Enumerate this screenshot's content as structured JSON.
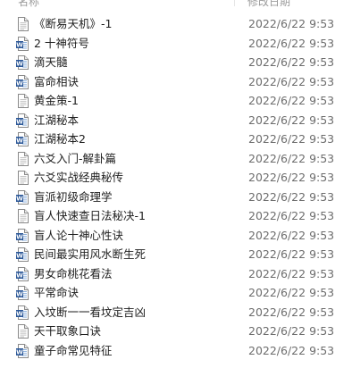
{
  "columns": {
    "name": "名称",
    "date": "修改日期"
  },
  "files": [
    {
      "name": "《断易天机》-1",
      "date": "2022/6/22 9:53",
      "icon": "text-document-icon"
    },
    {
      "name": "2 十神符号",
      "date": "2022/6/22 9:53",
      "icon": "word-document-icon"
    },
    {
      "name": "滴天髓",
      "date": "2022/6/22 9:53",
      "icon": "word-document-icon"
    },
    {
      "name": "富命相诀",
      "date": "2022/6/22 9:53",
      "icon": "word-document-icon"
    },
    {
      "name": "黄金策-1",
      "date": "2022/6/22 9:53",
      "icon": "text-document-icon"
    },
    {
      "name": "江湖秘本",
      "date": "2022/6/22 9:53",
      "icon": "word-document-icon"
    },
    {
      "name": "江湖秘本2",
      "date": "2022/6/22 9:53",
      "icon": "word-document-icon"
    },
    {
      "name": "六爻入门-解卦篇",
      "date": "2022/6/22 9:53",
      "icon": "text-document-icon"
    },
    {
      "name": "六爻实战经典秘传",
      "date": "2022/6/22 9:53",
      "icon": "text-document-icon"
    },
    {
      "name": "盲派初级命理学",
      "date": "2022/6/22 9:53",
      "icon": "word-document-icon"
    },
    {
      "name": "盲人快速查日法秘决-1",
      "date": "2022/6/22 9:53",
      "icon": "text-document-icon"
    },
    {
      "name": "盲人论十神心性诀",
      "date": "2022/6/22 9:53",
      "icon": "word-document-icon"
    },
    {
      "name": "民间最实用风水断生死",
      "date": "2022/6/22 9:53",
      "icon": "word-document-icon"
    },
    {
      "name": "男女命桃花看法",
      "date": "2022/6/22 9:53",
      "icon": "word-document-icon"
    },
    {
      "name": "平常命诀",
      "date": "2022/6/22 9:53",
      "icon": "word-document-icon"
    },
    {
      "name": "入坟断一一看坟定吉凶",
      "date": "2022/6/22 9:53",
      "icon": "word-document-icon"
    },
    {
      "name": "天干取象口诀",
      "date": "2022/6/22 9:53",
      "icon": "text-document-icon"
    },
    {
      "name": "童子命常见特征",
      "date": "2022/6/22 9:53",
      "icon": "word-document-icon"
    }
  ]
}
